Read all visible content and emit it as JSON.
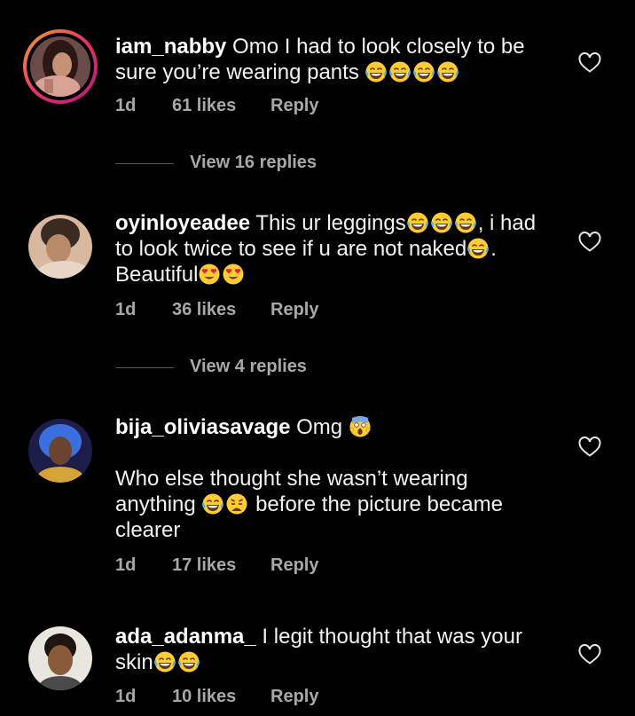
{
  "comments": [
    {
      "username": "iam_nabby",
      "line1": " Omo I had to look closely to be",
      "line2": "sure you’re wearing pants ",
      "time": "1d",
      "likes": "61 likes",
      "reply": "Reply",
      "view_replies": "View 16 replies"
    },
    {
      "username": "oyinloyeadee",
      "line1_text": " This ur leggings",
      "line1_tail": ", i had",
      "line2_text": "to look twice to see if u are not naked",
      "line2_tail": ".",
      "line3_text": "Beautiful",
      "time": "1d",
      "likes": "36 likes",
      "reply": "Reply",
      "view_replies": "View 4 replies"
    },
    {
      "username": "bija_oliviasavage",
      "line1": " Omg ",
      "line2": "Who else thought she wasn’t wearing",
      "line3_text": "anything ",
      "line3_tail": " before the picture became",
      "line4": "clearer",
      "time": "1d",
      "likes": "17 likes",
      "reply": "Reply"
    },
    {
      "username": "ada_adanma_",
      "line1": " I legit thought that was your",
      "line2_text": "skin",
      "time": "1d",
      "likes": "10 likes",
      "reply": "Reply"
    }
  ],
  "icons": {
    "like": "heart-outline-icon",
    "laugh": "face-with-tears-of-joy-emoji",
    "love": "smiling-face-with-heart-eyes-emoji",
    "scream": "face-screaming-in-fear-emoji",
    "weary": "weary-face-emoji"
  },
  "colors": {
    "background": "#000000",
    "text": "#f2f2f2",
    "meta": "#a8a8a8",
    "story_ring_start": "#f5a623",
    "story_ring_end": "#b3197c",
    "emoji_yellow": "#ffcc33"
  }
}
